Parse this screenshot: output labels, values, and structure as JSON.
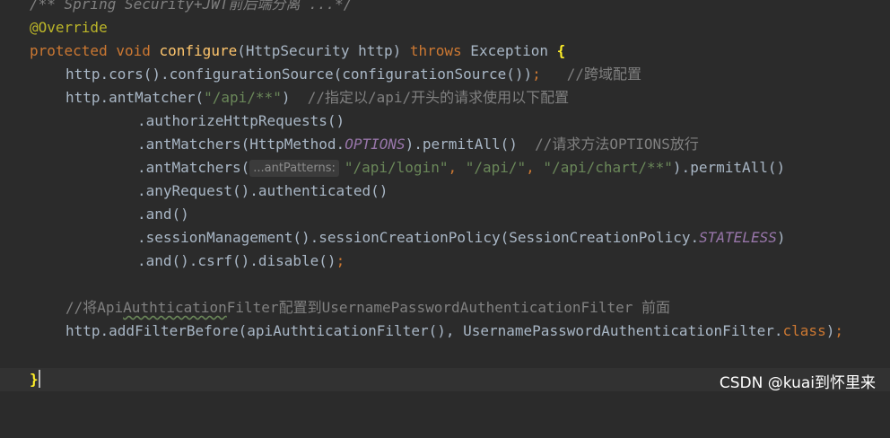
{
  "editor": {
    "lines": {
      "l1": {
        "comment": "/** Spring Security+JWT前后端分离 ...*/"
      },
      "l2": {
        "annotation": "@Override"
      },
      "l3": {
        "kw1": "protected",
        "kw2": "void",
        "method": "configure",
        "params": "(HttpSecurity http) ",
        "kw3": "throws",
        "exc": " Exception ",
        "brace": "{"
      },
      "l4": {
        "code": "http.cors().configurationSource(configurationSource())",
        "semi": ";",
        "comment": "//跨域配置"
      },
      "l5": {
        "code1": "http.antMatcher(",
        "str": "\"/api/**\"",
        "code2": ")",
        "comment": "//指定以/api/开头的请求使用以下配置"
      },
      "l6": {
        "code": ".authorizeHttpRequests()"
      },
      "l7": {
        "code1": ".antMatchers(HttpMethod.",
        "const": "OPTIONS",
        "code2": ").permitAll()",
        "comment": "//请求方法OPTIONS放行"
      },
      "l8": {
        "code1": ".antMatchers(",
        "hint": "...antPatterns:",
        "str1": "\"/api/login\"",
        "comma1": ", ",
        "str2": "\"/api/\"",
        "comma2": ", ",
        "str3": "\"/api/chart/**\"",
        "code2": ").permitAll()"
      },
      "l9": {
        "code": ".anyRequest().authenticated()"
      },
      "l10": {
        "code": ".and()"
      },
      "l11": {
        "code1": ".sessionManagement().sessionCreationPolicy(SessionCreationPolicy.",
        "const": "STATELESS",
        "code2": ")"
      },
      "l12": {
        "code": ".and().csrf().disable()",
        "semi": ";"
      },
      "l14": {
        "c1": "//将Api",
        "c2": "Authtication",
        "c3": "Filter配置到UsernamePasswordAuthenticationFilter 前面"
      },
      "l15": {
        "code1": "http.addFilterBefore(apiAuthticationFilter(), UsernamePasswordAuthenticationFilter.",
        "kw": "class",
        "code2": ")",
        "semi": ";"
      },
      "l17": {
        "brace": "}"
      }
    }
  },
  "watermark": "CSDN @kuai到怀里来",
  "colors": {
    "background": "#2b2b2b",
    "keyword": "#cc7832",
    "string": "#6a8759",
    "comment": "#808080",
    "method": "#ffc66d",
    "annotation": "#bbb529",
    "constant": "#9876aa",
    "text": "#a9b7c6"
  }
}
